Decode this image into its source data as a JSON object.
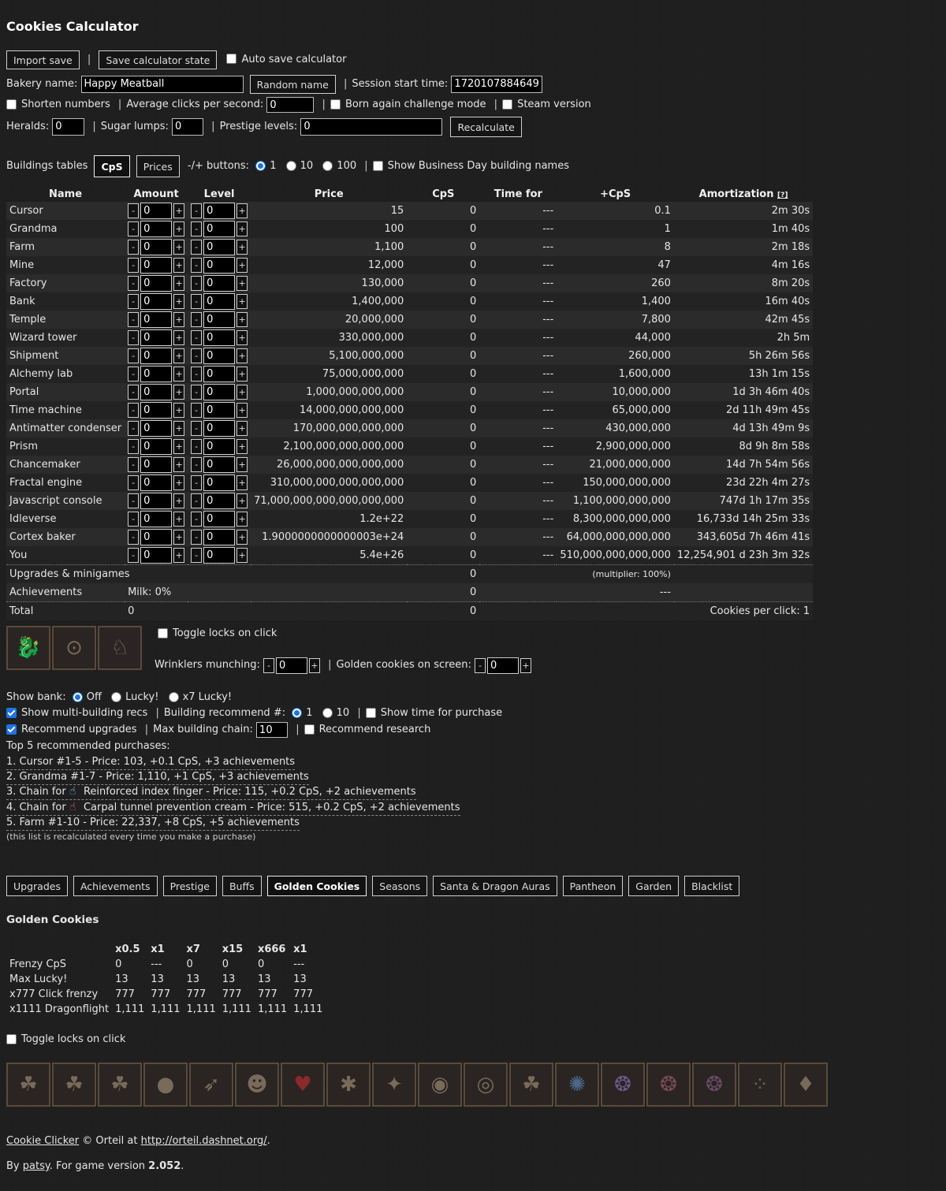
{
  "title": "Cookies Calculator",
  "toolbar": {
    "import_save": "Import save",
    "save_state": "Save calculator state",
    "auto_save": "Auto save calculator"
  },
  "bakery": {
    "label": "Bakery name:",
    "value": "Happy Meatball",
    "random": "Random name",
    "session_label": "Session start time:",
    "session_value": "1720107884649"
  },
  "options": {
    "shorten": "Shorten numbers",
    "avg_clicks_label": "Average clicks per second:",
    "avg_clicks": "0",
    "born_again": "Born again challenge mode",
    "steam": "Steam version",
    "heralds_label": "Heralds:",
    "heralds": "0",
    "sugar_label": "Sugar lumps:",
    "sugar": "0",
    "prestige_label": "Prestige levels:",
    "prestige": "0",
    "recalc": "Recalculate"
  },
  "tables_bar": {
    "label": "Buildings tables",
    "cps": "CpS",
    "prices": "Prices",
    "pm_label": "-/+ buttons:",
    "opt1": "1",
    "opt10": "10",
    "opt100": "100",
    "business": "Show Business Day building names"
  },
  "columns": {
    "name": "Name",
    "amount": "Amount",
    "level": "Level",
    "price": "Price",
    "cps": "CpS",
    "time": "Time for",
    "plus": "+CpS",
    "amort": "Amortization",
    "help": "[?]"
  },
  "buildings": [
    {
      "name": "Cursor",
      "amount": "0",
      "level": "0",
      "price": "15",
      "cps": "0",
      "time": "---",
      "plus": "0.1",
      "amort": "2m 30s"
    },
    {
      "name": "Grandma",
      "amount": "0",
      "level": "0",
      "price": "100",
      "cps": "0",
      "time": "---",
      "plus": "1",
      "amort": "1m 40s"
    },
    {
      "name": "Farm",
      "amount": "0",
      "level": "0",
      "price": "1,100",
      "cps": "0",
      "time": "---",
      "plus": "8",
      "amort": "2m 18s"
    },
    {
      "name": "Mine",
      "amount": "0",
      "level": "0",
      "price": "12,000",
      "cps": "0",
      "time": "---",
      "plus": "47",
      "amort": "4m 16s"
    },
    {
      "name": "Factory",
      "amount": "0",
      "level": "0",
      "price": "130,000",
      "cps": "0",
      "time": "---",
      "plus": "260",
      "amort": "8m 20s"
    },
    {
      "name": "Bank",
      "amount": "0",
      "level": "0",
      "price": "1,400,000",
      "cps": "0",
      "time": "---",
      "plus": "1,400",
      "amort": "16m 40s"
    },
    {
      "name": "Temple",
      "amount": "0",
      "level": "0",
      "price": "20,000,000",
      "cps": "0",
      "time": "---",
      "plus": "7,800",
      "amort": "42m 45s"
    },
    {
      "name": "Wizard tower",
      "amount": "0",
      "level": "0",
      "price": "330,000,000",
      "cps": "0",
      "time": "---",
      "plus": "44,000",
      "amort": "2h 5m"
    },
    {
      "name": "Shipment",
      "amount": "0",
      "level": "0",
      "price": "5,100,000,000",
      "cps": "0",
      "time": "---",
      "plus": "260,000",
      "amort": "5h 26m 56s"
    },
    {
      "name": "Alchemy lab",
      "amount": "0",
      "level": "0",
      "price": "75,000,000,000",
      "cps": "0",
      "time": "---",
      "plus": "1,600,000",
      "amort": "13h 1m 15s"
    },
    {
      "name": "Portal",
      "amount": "0",
      "level": "0",
      "price": "1,000,000,000,000",
      "cps": "0",
      "time": "---",
      "plus": "10,000,000",
      "amort": "1d 3h 46m 40s"
    },
    {
      "name": "Time machine",
      "amount": "0",
      "level": "0",
      "price": "14,000,000,000,000",
      "cps": "0",
      "time": "---",
      "plus": "65,000,000",
      "amort": "2d 11h 49m 45s"
    },
    {
      "name": "Antimatter condenser",
      "amount": "0",
      "level": "0",
      "price": "170,000,000,000,000",
      "cps": "0",
      "time": "---",
      "plus": "430,000,000",
      "amort": "4d 13h 49m 9s"
    },
    {
      "name": "Prism",
      "amount": "0",
      "level": "0",
      "price": "2,100,000,000,000,000",
      "cps": "0",
      "time": "---",
      "plus": "2,900,000,000",
      "amort": "8d 9h 8m 58s"
    },
    {
      "name": "Chancemaker",
      "amount": "0",
      "level": "0",
      "price": "26,000,000,000,000,000",
      "cps": "0",
      "time": "---",
      "plus": "21,000,000,000",
      "amort": "14d 7h 54m 56s"
    },
    {
      "name": "Fractal engine",
      "amount": "0",
      "level": "0",
      "price": "310,000,000,000,000,000",
      "cps": "0",
      "time": "---",
      "plus": "150,000,000,000",
      "amort": "23d 22h 4m 27s"
    },
    {
      "name": "Javascript console",
      "amount": "0",
      "level": "0",
      "price": "71,000,000,000,000,000,000",
      "cps": "0",
      "time": "---",
      "plus": "1,100,000,000,000",
      "amort": "747d 1h 17m 35s"
    },
    {
      "name": "Idleverse",
      "amount": "0",
      "level": "0",
      "price": "1.2e+22",
      "cps": "0",
      "time": "---",
      "plus": "8,300,000,000,000",
      "amort": "16,733d 14h 25m 33s"
    },
    {
      "name": "Cortex baker",
      "amount": "0",
      "level": "0",
      "price": "1.9000000000000003e+24",
      "cps": "0",
      "time": "---",
      "plus": "64,000,000,000,000",
      "amort": "343,605d 7h 46m 41s"
    },
    {
      "name": "You",
      "amount": "0",
      "level": "0",
      "price": "5.4e+26",
      "cps": "0",
      "time": "---",
      "plus": "510,000,000,000,000",
      "amort": "12,254,901 d 23h 3m 32s"
    }
  ],
  "summary": {
    "upgrades": "Upgrades & minigames",
    "upgrades_cps": "0",
    "multiplier": "(multiplier: 100%)",
    "achievements": "Achievements",
    "milk": "Milk: 0%",
    "ach_cps": "0",
    "ach_dash": "---",
    "total": "Total",
    "total_amount": "0",
    "total_cps": "0",
    "cookies_per_click": "Cookies per click: 1"
  },
  "minor": {
    "toggle_locks": "Toggle locks on click",
    "wrinklers_label": "Wrinklers munching:",
    "wrinklers": "0",
    "golden_label": "Golden cookies on screen:",
    "golden": "0"
  },
  "bank": {
    "label": "Show bank:",
    "off": "Off",
    "lucky": "Lucky!",
    "x7": "x7 Lucky!"
  },
  "recs": {
    "multi": "Show multi-building recs",
    "building_label": "Building recommend #:",
    "b1": "1",
    "b10": "10",
    "time_purchase": "Show time for purchase",
    "rec_upgrades": "Recommend upgrades",
    "max_chain_label": "Max building chain:",
    "max_chain": "10",
    "rec_research": "Recommend research",
    "top_label": "Top 5 recommended purchases:",
    "items": [
      "1. Cursor #1-5 - Price: 103, +0.1 CpS, +3 achievements",
      "2. Grandma #1-7 - Price: 1,110, +1 CpS, +3 achievements",
      "3. Chain for",
      "4. Chain for"
    ],
    "item3_rest": "Reinforced index finger - Price: 115, +0.2 CpS, +2 achievements",
    "item4_rest": "Carpal tunnel prevention cream - Price: 515, +0.2 CpS, +2 achievements",
    "item5": "5. Farm #1-10 - Price: 22,337, +8 CpS, +5 achievements",
    "note": "(this list is recalculated every time you make a purchase)"
  },
  "tabs": [
    "Upgrades",
    "Achievements",
    "Prestige",
    "Buffs",
    "Golden Cookies",
    "Seasons",
    "Santa & Dragon Auras",
    "Pantheon",
    "Garden",
    "Blacklist"
  ],
  "golden": {
    "heading": "Golden Cookies",
    "headers": [
      "",
      "x0.5",
      "x1",
      "x7",
      "x15",
      "x666",
      "x1"
    ],
    "rows": [
      [
        "Frenzy CpS",
        "0",
        "---",
        "0",
        "0",
        "0",
        "---"
      ],
      [
        "Max Lucky!",
        "13",
        "13",
        "13",
        "13",
        "13",
        "13"
      ],
      [
        "x777 Click frenzy",
        "777",
        "777",
        "777",
        "777",
        "777",
        "777"
      ],
      [
        "x1111 Dragonflight",
        "1,111",
        "1,111",
        "1,111",
        "1,111",
        "1,111",
        "1,111"
      ]
    ],
    "toggle_locks": "Toggle locks on click"
  },
  "footer": {
    "cc": "Cookie Clicker",
    "copy": " © Orteil at ",
    "url": "http://orteil.dashnet.org/",
    "dot": ".",
    "by": "By ",
    "author": "patsy",
    "version_text": ". For game version ",
    "version": "2.052",
    "end": "."
  }
}
